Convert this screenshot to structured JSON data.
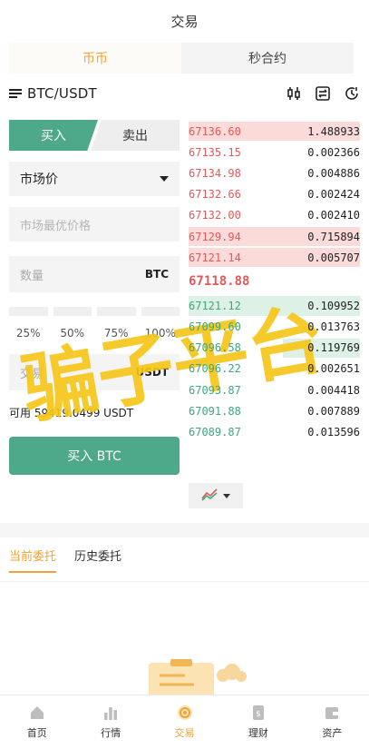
{
  "header": {
    "title": "交易"
  },
  "segments": [
    {
      "label": "币币",
      "active": true
    },
    {
      "label": "秒合约",
      "active": false
    }
  ],
  "pair": {
    "name": "BTC/USDT"
  },
  "trade": {
    "buy_tab": "买入",
    "sell_tab": "卖出",
    "order_type": "市场价",
    "price_placeholder": "市场最优价格",
    "qty_label": "数量",
    "qty_unit": "BTC",
    "percents": [
      "25%",
      "50%",
      "75%",
      "100%"
    ],
    "amount_label": "交易",
    "amount_unit": "USDT",
    "available": "可用 59419.0499 USDT",
    "submit": "买入 BTC"
  },
  "orderbook": {
    "asks": [
      {
        "price": "67136.60",
        "qty": "1.488933",
        "depth": 1.0
      },
      {
        "price": "67135.15",
        "qty": "0.002366",
        "depth": 0.0
      },
      {
        "price": "67134.98",
        "qty": "0.004886",
        "depth": 0.0
      },
      {
        "price": "67132.66",
        "qty": "0.002424",
        "depth": 0.0
      },
      {
        "price": "67132.00",
        "qty": "0.002410",
        "depth": 0.0
      },
      {
        "price": "67129.94",
        "qty": "0.715894",
        "depth": 1.0
      },
      {
        "price": "67121.14",
        "qty": "0.005707",
        "depth": 1.0
      }
    ],
    "last_price": "67118.88",
    "bids": [
      {
        "price": "67121.12",
        "qty": "0.109952",
        "depth": 1.0
      },
      {
        "price": "67099.60",
        "qty": "0.013763",
        "depth": 0.0
      },
      {
        "price": "67096.58",
        "qty": "0.119769",
        "depth": 0.45
      },
      {
        "price": "67096.22",
        "qty": "0.002651",
        "depth": 0.0
      },
      {
        "price": "67093.87",
        "qty": "0.004418",
        "depth": 0.0
      },
      {
        "price": "67091.88",
        "qty": "0.007889",
        "depth": 0.0
      },
      {
        "price": "67089.87",
        "qty": "0.013596",
        "depth": 0.0
      }
    ]
  },
  "orders": {
    "tabs": [
      {
        "label": "当前委托",
        "active": true
      },
      {
        "label": "历史委托",
        "active": false
      }
    ]
  },
  "watermark": {
    "text": "骗子平台",
    "color": "#f5c518"
  },
  "tabbar": [
    {
      "label": "首页",
      "icon": "home-icon",
      "active": false
    },
    {
      "label": "行情",
      "icon": "chart-bars-icon",
      "active": false
    },
    {
      "label": "交易",
      "icon": "trade-icon",
      "active": true
    },
    {
      "label": "理财",
      "icon": "wallet-doc-icon",
      "active": false
    },
    {
      "label": "资产",
      "icon": "asset-icon",
      "active": false
    }
  ],
  "colors": {
    "accent": "#f0a33a",
    "buy": "#4ea98a",
    "ask": "#df5a5a",
    "bid": "#3ea77b"
  }
}
